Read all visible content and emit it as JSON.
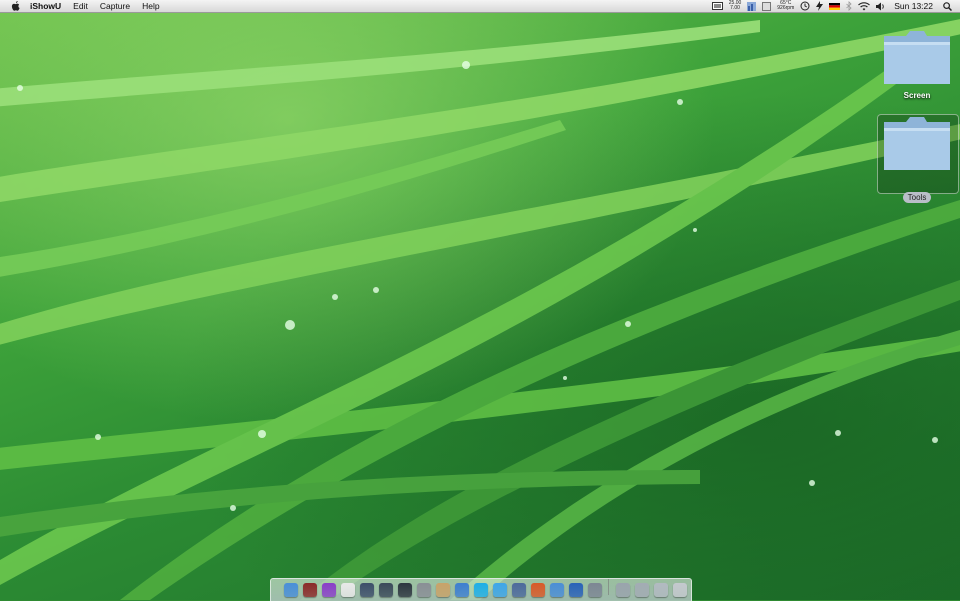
{
  "menubar": {
    "apple_icon": "apple-icon",
    "app_name": "iShowU",
    "menus": [
      "Edit",
      "Capture",
      "Help"
    ],
    "cpu_meter": {
      "top": "25.00",
      "bottom": "7.00"
    },
    "weather": {
      "top": "65°C",
      "bottom": "926rpm"
    },
    "clock": "Sun 13:22"
  },
  "desktop": {
    "icons": [
      {
        "label": "Screen",
        "selected": false
      },
      {
        "label": "Tools",
        "selected": true
      }
    ]
  },
  "dock": {
    "apps": [
      {
        "name": "finder-icon",
        "color": "#4a8fd8"
      },
      {
        "name": "photo-booth-icon",
        "color": "#8b2a2a"
      },
      {
        "name": "app-purple-icon",
        "color": "#8a3fc8"
      },
      {
        "name": "ical-icon",
        "color": "#e9e9e9"
      },
      {
        "name": "dashboard-icon",
        "color": "#3d4e6a"
      },
      {
        "name": "time-machine-icon",
        "color": "#3b4a5a"
      },
      {
        "name": "activity-monitor-icon",
        "color": "#2d3640"
      },
      {
        "name": "disk-utility-icon",
        "color": "#8a8f96"
      },
      {
        "name": "preview-icon",
        "color": "#c8a36a"
      },
      {
        "name": "xcode-icon",
        "color": "#3e7fd0"
      },
      {
        "name": "skype-icon",
        "color": "#1faee6"
      },
      {
        "name": "ichat-icon",
        "color": "#3fa6e8"
      },
      {
        "name": "remote-icon",
        "color": "#4d6a9c"
      },
      {
        "name": "firefox-icon",
        "color": "#d85a2a"
      },
      {
        "name": "safari-icon",
        "color": "#4b8ed6"
      },
      {
        "name": "ishowu-icon",
        "color": "#2a62b8"
      },
      {
        "name": "system-preferences-icon",
        "color": "#7d8794"
      }
    ],
    "stacks": [
      {
        "name": "applications-stack-icon",
        "color": "#9aa4ad"
      },
      {
        "name": "documents-stack-icon",
        "color": "#a3acb4"
      },
      {
        "name": "downloads-stack-icon",
        "color": "#b2bac1"
      },
      {
        "name": "trash-icon",
        "color": "#c4c9ce"
      }
    ]
  }
}
